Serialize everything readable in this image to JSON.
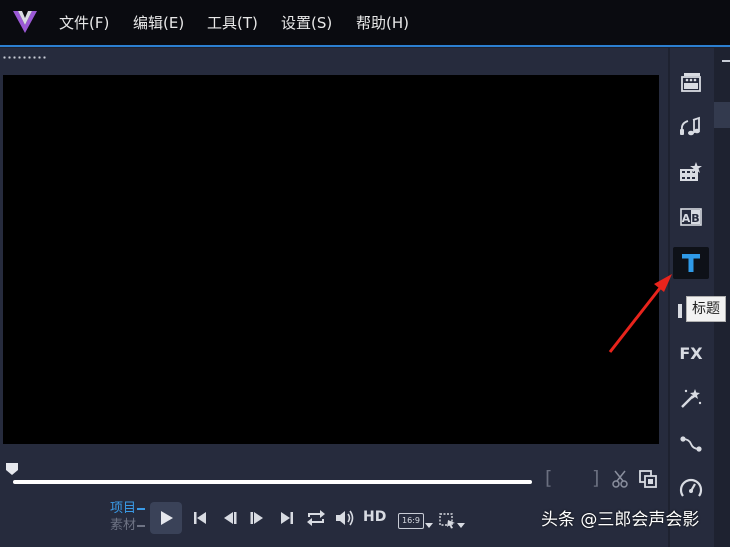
{
  "menu": {
    "file": "文件(F)",
    "edit": "编辑(E)",
    "tools": "工具(T)",
    "settings": "设置(S)",
    "help": "帮助(H)"
  },
  "playback": {
    "project_label": "项目",
    "clip_label": "素材",
    "hd_label": "HD",
    "aspect_ratio": "16:9",
    "bracket_in": "[",
    "bracket_out": "]"
  },
  "toolbar": {
    "items": [
      {
        "icon": "media-icon"
      },
      {
        "icon": "instant-project-icon"
      },
      {
        "icon": "transition-icon"
      },
      {
        "icon": "ab-transition-icon"
      },
      {
        "icon": "title-icon",
        "active": true
      },
      {
        "icon": "graphics-icon"
      },
      {
        "label": "FX"
      },
      {
        "icon": "filter-wand-icon"
      },
      {
        "icon": "path-icon"
      },
      {
        "icon": "speed-icon"
      }
    ],
    "tooltip": "标题"
  },
  "watermark": "头条 @三郎会声会影",
  "colors": {
    "accent": "#2c7fd0",
    "title_icon": "#2f9ae8",
    "annotation_arrow": "#e8241c",
    "mode_active": "#3a9be8"
  }
}
